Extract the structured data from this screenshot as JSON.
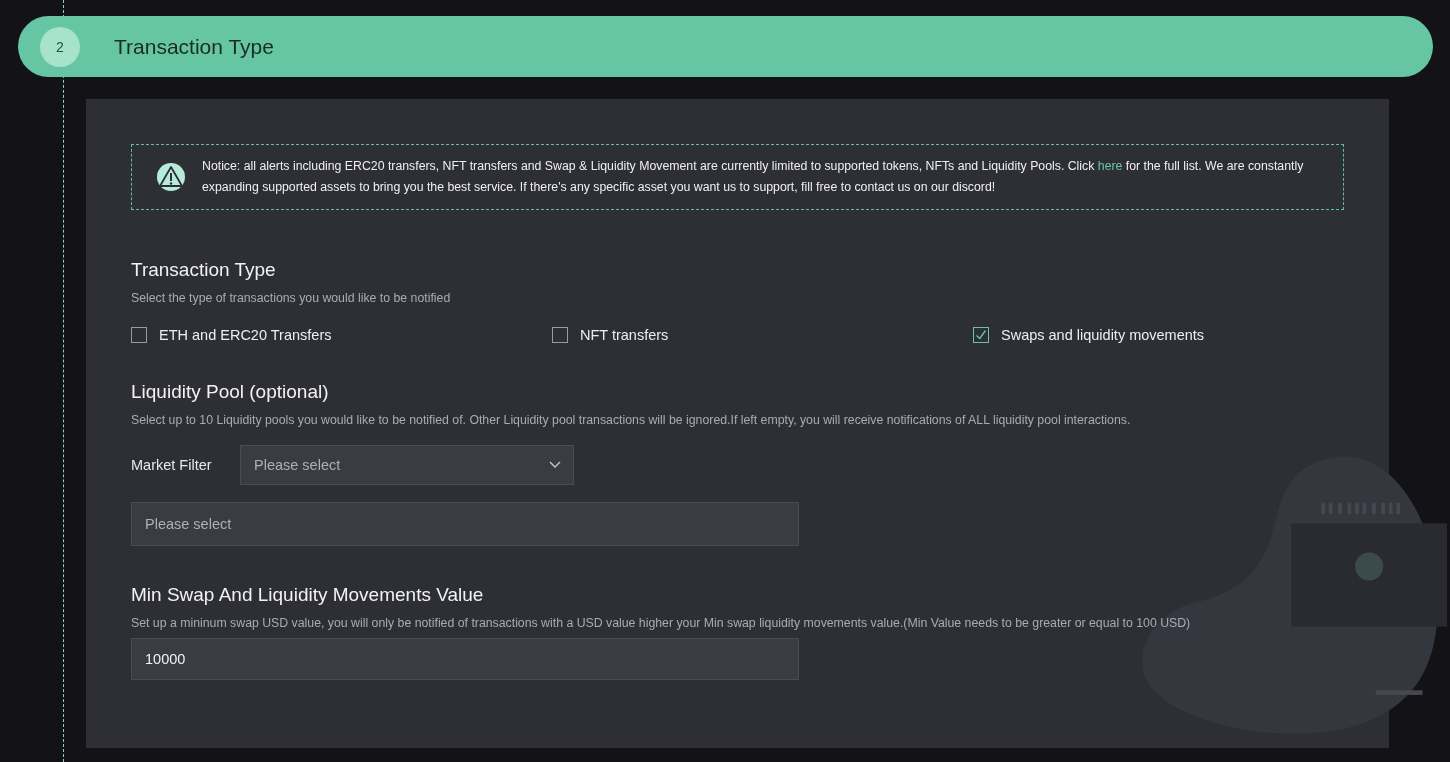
{
  "step": {
    "number": "2",
    "title": "Transaction Type"
  },
  "notice": {
    "before": "Notice: all alerts including ERC20 transfers, NFT transfers and Swap & Liquidity Movement are currently limited to supported tokens, NFTs and Liquidity Pools. Click ",
    "link": "here",
    "after": " for the full list. We are constantly expanding supported assets to bring you the best service. If there's any specific asset you want us to support, fill free to contact us on our discord!"
  },
  "transaction_type": {
    "title": "Transaction Type",
    "hint": "Select the type of transactions you would like to be notified",
    "options": [
      {
        "label": "ETH and ERC20 Transfers",
        "checked": false
      },
      {
        "label": "NFT transfers",
        "checked": false
      },
      {
        "label": "Swaps and liquidity movements",
        "checked": true
      }
    ]
  },
  "liquidity_pool": {
    "title": "Liquidity Pool (optional)",
    "hint": "Select up to 10 Liquidity pools you would like to be notified of. Other Liquidity pool transactions will be ignored.If left empty, you will receive notifications of ALL liquidity pool interactions.",
    "market_filter_label": "Market Filter",
    "market_filter": {
      "placeholder": "Please select"
    },
    "pools": {
      "placeholder": "Please select"
    }
  },
  "min_value": {
    "title": "Min Swap And Liquidity Movements Value",
    "hint": "Set up a mininum swap USD value, you will only be notified of transactions with a USD value higher your Min swap liquidity movements value.(Min Value needs to be greater or equal to 100 USD)",
    "value": "10000"
  }
}
